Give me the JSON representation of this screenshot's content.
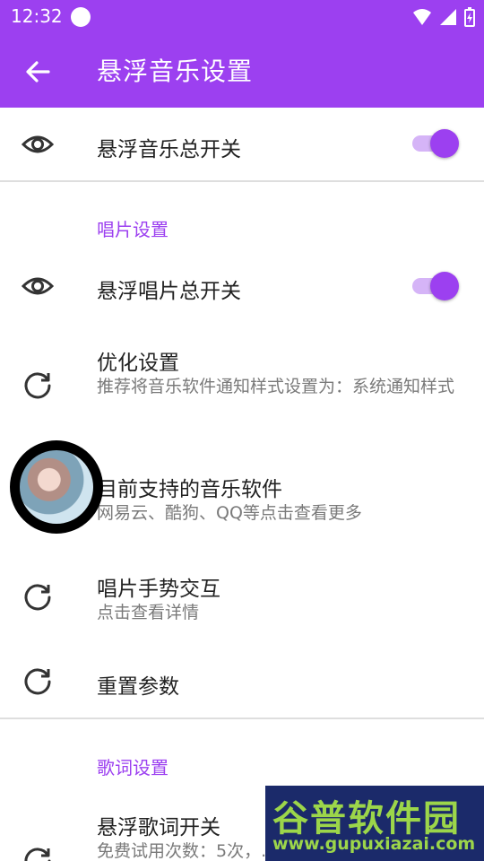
{
  "status_bar": {
    "time": "12:32"
  },
  "app_bar": {
    "title": "悬浮音乐设置"
  },
  "rows": {
    "master_switch": {
      "label": "悬浮音乐总开关",
      "on": true
    },
    "disc_section": {
      "header": "唱片设置"
    },
    "disc_switch": {
      "label": "悬浮唱片总开关",
      "on": true
    },
    "optimize": {
      "label": "优化设置",
      "sub": "推荐将音乐软件通知样式设置为：系统通知样式"
    },
    "supported": {
      "label": "目前支持的音乐软件",
      "sub": "网易云、酷狗、QQ等点击查看更多"
    },
    "gesture": {
      "label": "唱片手势交互",
      "sub": "点击查看详情"
    },
    "reset": {
      "label": "重置参数"
    },
    "lyrics_section": {
      "header": "歌词设置"
    },
    "lyrics_switch": {
      "label": "悬浮歌词开关",
      "sub": "免费试用次数：5次，..."
    }
  },
  "watermark": {
    "title": "谷普软件园",
    "url": "www.gupuxiazai.com"
  },
  "colors": {
    "accent": "#9c40f0",
    "track": "#d5b4f7"
  },
  "icons": {
    "back": "arrow-left-icon",
    "eye": "eye-icon",
    "refresh": "refresh-icon"
  }
}
